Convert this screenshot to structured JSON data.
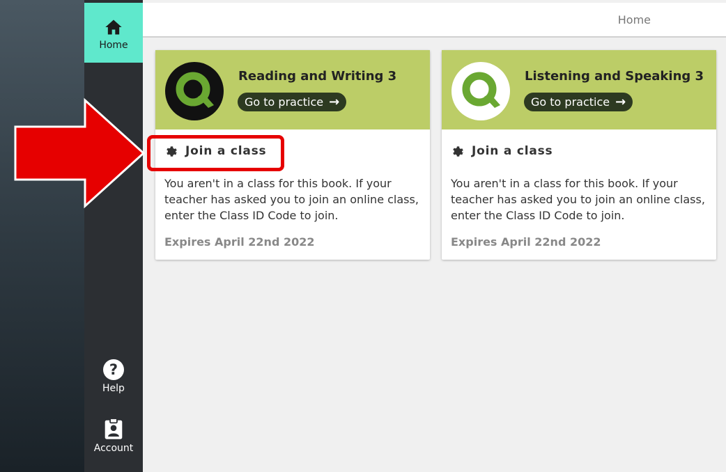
{
  "sidebar": {
    "home_label": "Home",
    "help_label": "Help",
    "account_label": "Account"
  },
  "header": {
    "title": "Home"
  },
  "cards": [
    {
      "title": "Reading and Writing 3",
      "practice_label": "Go to practice",
      "join_label": "Join a class",
      "description": "You aren't in a class for this book. If your teacher has asked you to join an online class, enter the Class ID Code to join.",
      "expires": "Expires April 22nd 2022",
      "logo_style": "dark"
    },
    {
      "title": "Listening and Speaking 3",
      "practice_label": "Go to practice",
      "join_label": "Join a class",
      "description": "You aren't in a class for this book. If your teacher has asked you to join an online class, enter the Class ID Code to join.",
      "expires": "Expires April 22nd 2022",
      "logo_style": "light"
    }
  ],
  "colors": {
    "accent": "#5fe8cc",
    "card_header": "#bccd67",
    "annotation": "#e60000"
  },
  "icons": [
    "home-icon",
    "help-icon",
    "account-icon",
    "gear-icon",
    "arrow-right-icon",
    "q-logo-icon"
  ]
}
